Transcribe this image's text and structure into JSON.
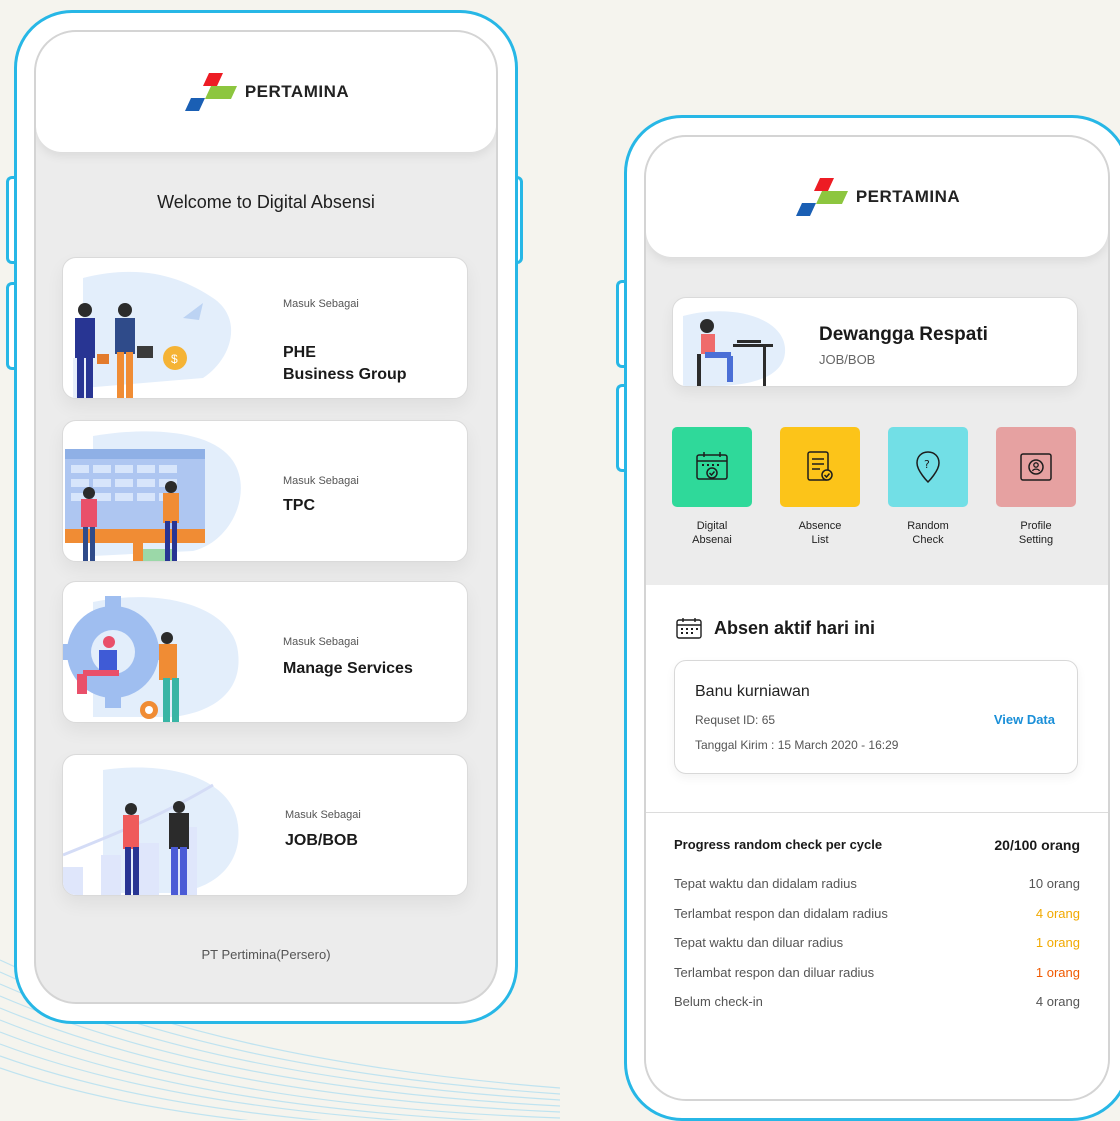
{
  "brand": {
    "logo_text": "PERTAMINA"
  },
  "login_screen": {
    "welcome": "Welcome to Digital Absensi",
    "roles": [
      {
        "sub": "Masuk Sebagai",
        "line1": "PHE",
        "line2": "Business Group"
      },
      {
        "sub": "Masuk Sebagai",
        "line1": "TPC",
        "line2": ""
      },
      {
        "sub": "Masuk Sebagai",
        "line1": "Manage Services",
        "line2": ""
      },
      {
        "sub": "Masuk Sebagai",
        "line1": "JOB/BOB",
        "line2": ""
      }
    ],
    "footer": "PT Pertimina(Persero)"
  },
  "dashboard": {
    "profile": {
      "name": "Dewangga Respati",
      "role": "JOB/BOB"
    },
    "menu": [
      {
        "line1": "Digital",
        "line2": "Absenai",
        "color": "#2fd99a",
        "icon": "calendar-check-icon"
      },
      {
        "line1": "Absence",
        "line2": "List",
        "color": "#fcc419",
        "icon": "document-check-icon"
      },
      {
        "line1": "Random",
        "line2": "Check",
        "color": "#72dfe6",
        "icon": "location-question-icon"
      },
      {
        "line1": "Profile",
        "line2": "Setting",
        "color": "#e6a1a1",
        "icon": "profile-id-icon"
      }
    ],
    "section_title": "Absen aktif hari ini",
    "request": {
      "name": "Banu kurniawan",
      "id": "Requset ID: 65",
      "date": "Tanggal Kirim : 15 March 2020 - 16:29",
      "action": "View Data"
    },
    "progress": {
      "title": "Progress random check per cycle",
      "total": "20/100 orang",
      "rows": [
        {
          "label": "Tepat waktu dan didalam radius",
          "value": "10 orang",
          "color": "#555555"
        },
        {
          "label": "Terlambat respon dan didalam radius",
          "value": "4 orang",
          "color": "#f2a900"
        },
        {
          "label": "Tepat waktu dan diluar radius",
          "value": "1 orang",
          "color": "#f2a900"
        },
        {
          "label": "Terlambat respon dan diluar radius",
          "value": "1 orang",
          "color": "#f05a00"
        },
        {
          "label": "Belum check-in",
          "value": "4 orang",
          "color": "#555555"
        }
      ]
    }
  }
}
